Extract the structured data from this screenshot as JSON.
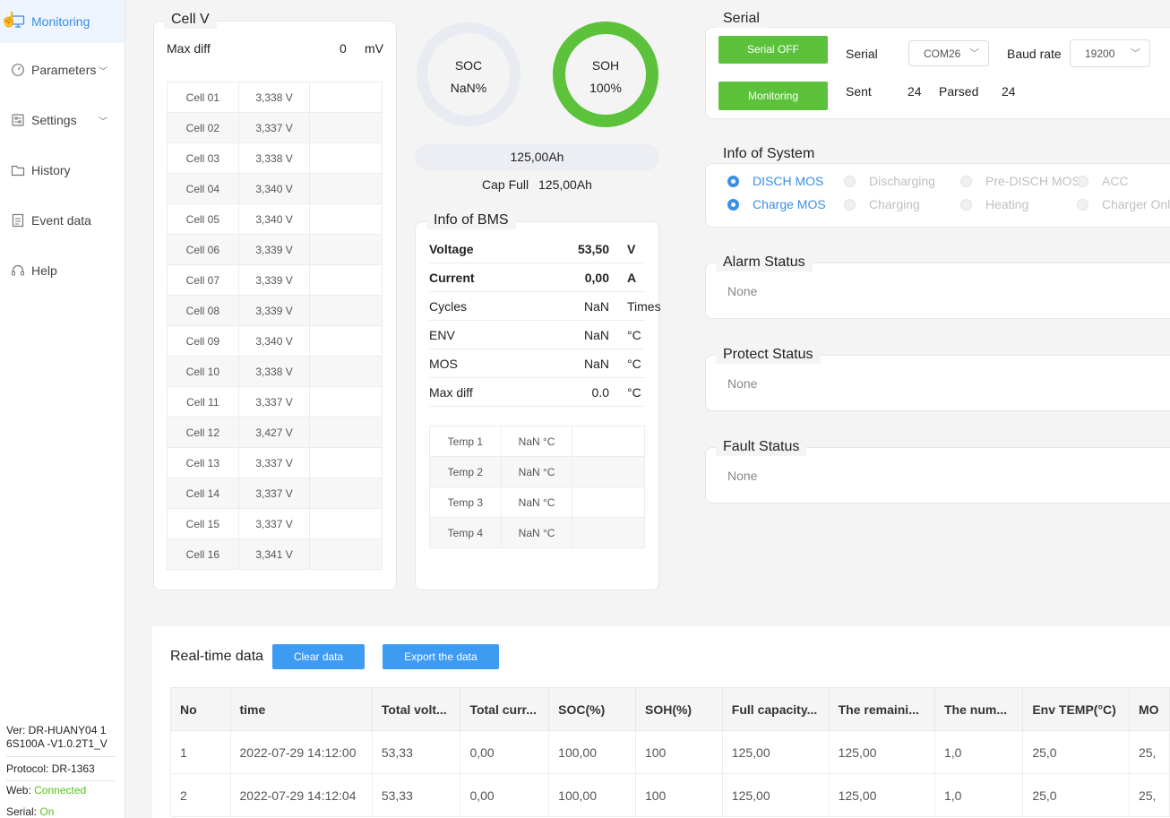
{
  "sidebar": {
    "items": [
      {
        "label": "Monitoring",
        "icon": "monitor-icon",
        "active": true
      },
      {
        "label": "Parameters",
        "icon": "gauge-icon",
        "expandable": true
      },
      {
        "label": "Settings",
        "icon": "sliders-icon",
        "expandable": true
      },
      {
        "label": "History",
        "icon": "folder-icon"
      },
      {
        "label": "Event data",
        "icon": "document-icon"
      },
      {
        "label": "Help",
        "icon": "headset-icon"
      }
    ],
    "version_label": "Ver: DR-HUANY04   1 6S100A   -V1.0.2T1_V",
    "protocol_label": "Protocol: DR-1363",
    "web_label": "Web:",
    "web_value": "Connected",
    "serial_label": "Serial:",
    "serial_value": "On"
  },
  "cellv": {
    "title": "Cell V",
    "maxdiff_label": "Max diff",
    "maxdiff_value": "0",
    "maxdiff_unit": "mV",
    "cells": [
      {
        "name": "Cell 01",
        "value": "3,338 V"
      },
      {
        "name": "Cell 02",
        "value": "3,337 V"
      },
      {
        "name": "Cell 03",
        "value": "3,338 V"
      },
      {
        "name": "Cell 04",
        "value": "3,340 V"
      },
      {
        "name": "Cell 05",
        "value": "3,340 V"
      },
      {
        "name": "Cell 06",
        "value": "3,339 V"
      },
      {
        "name": "Cell 07",
        "value": "3,339 V"
      },
      {
        "name": "Cell 08",
        "value": "3,339 V"
      },
      {
        "name": "Cell 09",
        "value": "3,340 V"
      },
      {
        "name": "Cell 10",
        "value": "3,338 V"
      },
      {
        "name": "Cell 11",
        "value": "3,337 V"
      },
      {
        "name": "Cell 12",
        "value": "3,427 V"
      },
      {
        "name": "Cell 13",
        "value": "3,337 V"
      },
      {
        "name": "Cell 14",
        "value": "3,337 V"
      },
      {
        "name": "Cell 15",
        "value": "3,337 V"
      },
      {
        "name": "Cell 16",
        "value": "3,341 V"
      }
    ]
  },
  "gauges": {
    "soc_label": "SOC",
    "soc_value": "NaN%",
    "soh_label": "SOH",
    "soh_value": "100%",
    "soh_fraction": 1.0,
    "soc_fraction": 0,
    "colors": {
      "soh": "#5cc23b",
      "soc_track": "#e8ebf2"
    }
  },
  "capacity": {
    "remaining": "125,00Ah",
    "full_label": "Cap Full",
    "full_value": "125,00Ah"
  },
  "bms": {
    "title": "Info of BMS",
    "rows": [
      {
        "label": "Voltage",
        "value": "53,50",
        "unit": "V",
        "bold": true
      },
      {
        "label": "Current",
        "value": "0,00",
        "unit": "A",
        "bold": true
      },
      {
        "label": "Cycles",
        "value": "NaN",
        "unit": "Times"
      },
      {
        "label": "ENV",
        "value": "NaN",
        "unit": "°C"
      },
      {
        "label": "MOS",
        "value": "NaN",
        "unit": "°C"
      },
      {
        "label": "Max diff",
        "value": "0.0",
        "unit": "°C"
      }
    ],
    "temps": [
      {
        "name": "Temp 1",
        "value": "NaN °C"
      },
      {
        "name": "Temp 2",
        "value": "NaN °C"
      },
      {
        "name": "Temp 3",
        "value": "NaN °C"
      },
      {
        "name": "Temp 4",
        "value": "NaN °C"
      }
    ]
  },
  "serial": {
    "title": "Serial",
    "serial_off_button": "Serial OFF",
    "monitoring_button": "Monitoring",
    "serial_label": "Serial",
    "serial_port": "COM26",
    "baud_label": "Baud rate",
    "baud_value": "19200",
    "sent_label": "Sent",
    "sent_value": "24",
    "parsed_label": "Parsed",
    "parsed_value": "24"
  },
  "system": {
    "title": "Info of System",
    "indicators": [
      {
        "label": "DISCH MOS",
        "on": true
      },
      {
        "label": "Discharging",
        "on": false
      },
      {
        "label": "Pre-DISCH MOS",
        "on": false
      },
      {
        "label": "ACC",
        "on": false
      },
      {
        "label": "Charge MOS",
        "on": true
      },
      {
        "label": "Charging",
        "on": false
      },
      {
        "label": "Heating",
        "on": false
      },
      {
        "label": "Charger Onl",
        "on": false
      }
    ]
  },
  "alarm": {
    "title": "Alarm Status",
    "value": "None"
  },
  "protect": {
    "title": "Protect Status",
    "value": "None"
  },
  "fault": {
    "title": "Fault Status",
    "value": "None"
  },
  "realtime": {
    "title": "Real-time data",
    "clear_button": "Clear data",
    "export_button": "Export the data",
    "columns": [
      "No",
      "time",
      "Total volt...",
      "Total curr...",
      "SOC(%)",
      "SOH(%)",
      "Full capacity...",
      "The remaini...",
      "The num...",
      "Env TEMP(°C)",
      "MO"
    ],
    "rows": [
      [
        "1",
        "2022-07-29 14:12:00",
        "53,33",
        "0,00",
        "100,00",
        "100",
        "125,00",
        "125,00",
        "1,0",
        "25,0",
        "25,"
      ],
      [
        "2",
        "2022-07-29 14:12:04",
        "53,33",
        "0,00",
        "100,00",
        "100",
        "125,00",
        "125,00",
        "1,0",
        "25,0",
        "25,"
      ]
    ]
  }
}
